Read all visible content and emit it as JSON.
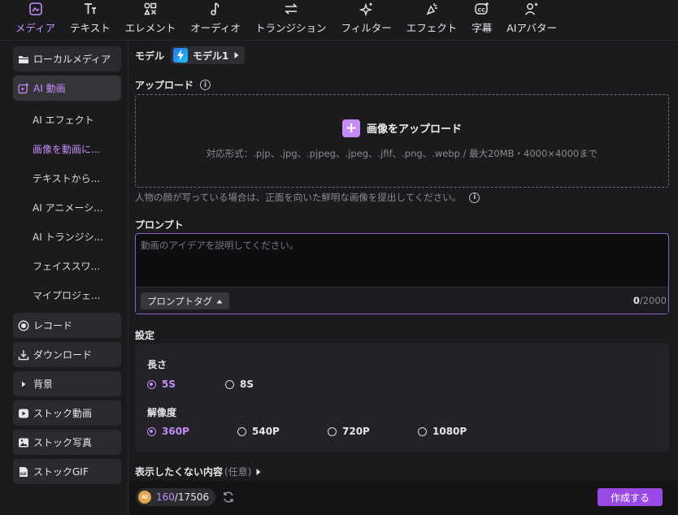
{
  "tabs": [
    {
      "label": "メディア",
      "icon": "media-icon",
      "active": true
    },
    {
      "label": "テキスト",
      "icon": "text-icon"
    },
    {
      "label": "エレメント",
      "icon": "elements-icon"
    },
    {
      "label": "オーディオ",
      "icon": "audio-icon"
    },
    {
      "label": "トランジション",
      "icon": "transition-icon"
    },
    {
      "label": "フィルター",
      "icon": "filter-icon"
    },
    {
      "label": "エフェクト",
      "icon": "effect-icon"
    },
    {
      "label": "字幕",
      "icon": "captions-icon"
    },
    {
      "label": "AIアバター",
      "icon": "ai-avatar-icon"
    }
  ],
  "sidebar": {
    "local_media": "ローカルメディア",
    "ai_video": "AI 動画",
    "sub": [
      "AI エフェクト",
      "画像を動画に...",
      "テキストから...",
      "AI アニメーシ...",
      "AI トランジシ...",
      "フェイススワ...",
      "マイプロジェ..."
    ],
    "record": "レコード",
    "download": "ダウンロード",
    "background": "背景",
    "stock_video": "ストック動画",
    "stock_photo": "ストック写真",
    "stock_gif": "ストックGIF",
    "gif_icon_text": "GIF"
  },
  "model": {
    "label": "モデル",
    "value": "モデル1"
  },
  "upload": {
    "title": "アップロード",
    "button": "画像をアップロード",
    "hint": "対応形式：.pjp、.jpg、.pjpeg、.jpeg、.jfif、.png、.webp / 最大20MB・4000×4000まで",
    "note": "人物の顔が写っている場合は、正面を向いた鮮明な画像を提出してください。"
  },
  "prompt": {
    "title": "プロンプト",
    "placeholder": "動画のアイデアを説明してください。",
    "tag_button": "プロンプトタグ",
    "count": "0",
    "max": "/2000"
  },
  "settings": {
    "title": "設定",
    "length_label": "長さ",
    "lengths": [
      "5S",
      "8S"
    ],
    "resolution_label": "解像度",
    "resolutions": [
      "360P",
      "540P",
      "720P",
      "1080P"
    ]
  },
  "exclude": {
    "label": "表示したくない内容",
    "optional": "(任意)"
  },
  "bottom": {
    "credits_used": "160",
    "credits_total": "/17506",
    "coin_text": "AI",
    "create_button": "作成する"
  },
  "colors": {
    "accent": "#c58cf8",
    "button": "#9a49e4"
  }
}
